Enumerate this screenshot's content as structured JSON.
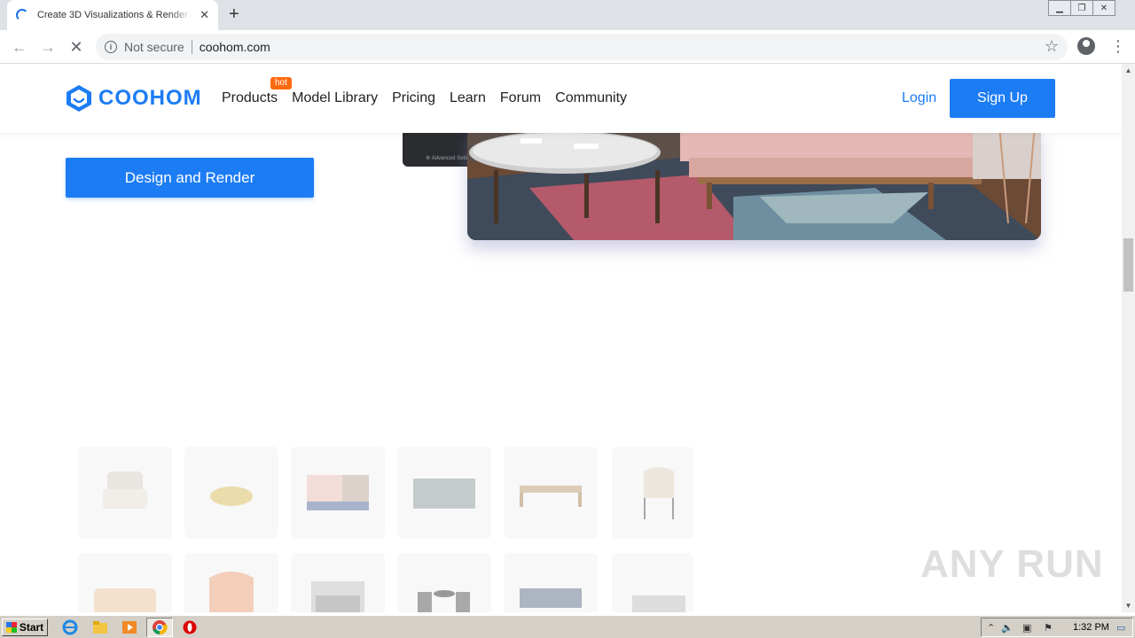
{
  "browser": {
    "tab_title": "Create 3D Visualizations & Render in",
    "tab_close": "✕",
    "new_tab": "+",
    "security_text": "Not secure",
    "url": "coohom.com",
    "window_controls": [
      "minimize",
      "restore",
      "close"
    ]
  },
  "site": {
    "logo_text": "COOHOM",
    "nav": [
      {
        "label": "Products",
        "badge": "hot"
      },
      {
        "label": "Model Library"
      },
      {
        "label": "Pricing"
      },
      {
        "label": "Learn"
      },
      {
        "label": "Forum"
      },
      {
        "label": "Community"
      }
    ],
    "login": "Login",
    "signup": "Sign Up",
    "hero_button": "Design and Render",
    "panel_caption": "⚙ Advanced Setti"
  },
  "watermark": "ANY RUN",
  "taskbar": {
    "start": "Start",
    "clock": "1:32 PM"
  },
  "colors": {
    "brand_blue": "#1c7cf4",
    "hot_badge": "#ff6a10"
  }
}
